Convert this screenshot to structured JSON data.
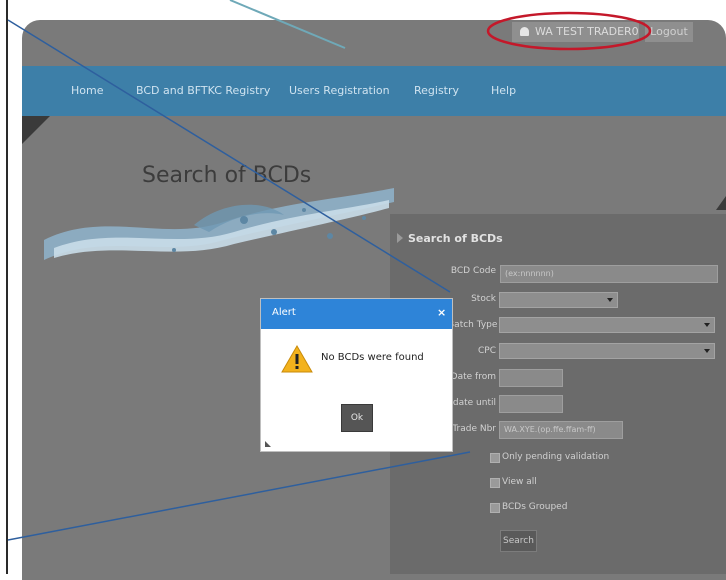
{
  "header": {
    "user": "WA TEST TRADER01",
    "logout": "Logout"
  },
  "nav": {
    "items": [
      "Home",
      "BCD and BFTKC Registry",
      "Users Registration",
      "Registry",
      "Help"
    ]
  },
  "page": {
    "title": "Search of BCDs"
  },
  "panel": {
    "title": "Search of BCDs",
    "fields": {
      "bcd_code": {
        "label": "BCD Code",
        "placeholder": "(ex:nnnnnn)"
      },
      "stock": {
        "label": "Stock"
      },
      "batch_type": {
        "label": "Batch Type"
      },
      "cpc": {
        "label": "CPC"
      },
      "date_from": {
        "label": "Date from"
      },
      "date_until": {
        "label": "date until"
      },
      "trade_nbr": {
        "label": "Trade Nbr",
        "value": "WA.XYE.(op.ffe.ffam-ff)"
      }
    },
    "checks": [
      "Only pending validation",
      "View all",
      "BCDs Grouped"
    ],
    "search": "Search"
  },
  "dialog": {
    "title": "Alert",
    "close": "×",
    "message": "No BCDs were found",
    "ok": "Ok"
  },
  "colors": {
    "nav": "#3d7fa8",
    "dialog_header": "#2e84d8",
    "highlight_ring": "#c4182a",
    "annotation_line": "#2e5f9e"
  },
  "icons": {
    "user": "user-icon",
    "warning": "warning-icon",
    "close": "close-icon"
  }
}
